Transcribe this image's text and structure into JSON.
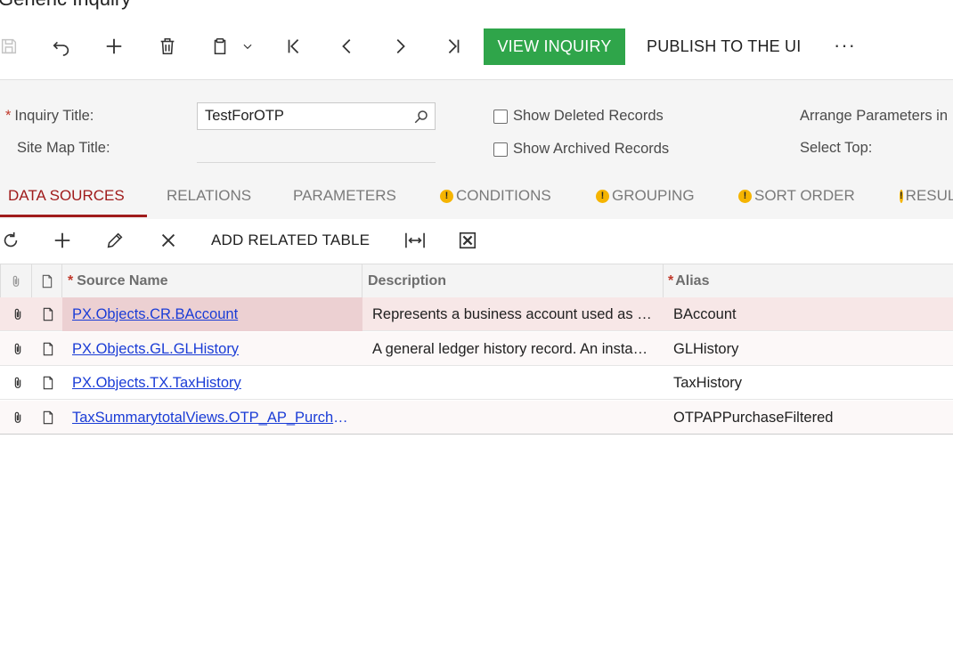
{
  "page": {
    "title": "Generic Inquiry"
  },
  "toolbar": {
    "view_inquiry": "VIEW INQUIRY",
    "publish": "PUBLISH TO THE UI",
    "more": "···",
    "accent": "#2fa54a"
  },
  "form": {
    "inquiry_title_label": "Inquiry Title:",
    "inquiry_title_value": "TestForOTP",
    "site_map_title_label": "Site Map Title:",
    "show_deleted_label": "Show Deleted Records",
    "show_archived_label": "Show Archived Records",
    "arrange_params_label": "Arrange Parameters in",
    "select_top_label": "Select Top:"
  },
  "tabs": [
    {
      "label": "DATA SOURCES",
      "active": true,
      "warning": false
    },
    {
      "label": "RELATIONS",
      "active": false,
      "warning": false
    },
    {
      "label": "PARAMETERS",
      "active": false,
      "warning": false
    },
    {
      "label": "CONDITIONS",
      "active": false,
      "warning": true
    },
    {
      "label": "GROUPING",
      "active": false,
      "warning": true
    },
    {
      "label": "SORT ORDER",
      "active": false,
      "warning": true
    },
    {
      "label": "RESULTS",
      "active": false,
      "warning": true
    }
  ],
  "grid_toolbar": {
    "add_related_table": "ADD RELATED TABLE"
  },
  "grid": {
    "columns": {
      "source_name": "Source Name",
      "description": "Description",
      "alias": "Alias"
    },
    "rows": [
      {
        "source": "PX.Objects.CR.BAccount",
        "description": "Represents a business account used as a base",
        "alias": "BAccount"
      },
      {
        "source": "PX.Objects.GL.GLHistory",
        "description": "A general ledger history record. An instance of",
        "alias": "GLHistory"
      },
      {
        "source": "PX.Objects.TX.TaxHistory",
        "description": "",
        "alias": "TaxHistory"
      },
      {
        "source": "TaxSummarytotalViews.OTP_AP_PurchaseFiltered",
        "description": "",
        "alias": "OTPAPPurchaseFiltered"
      }
    ]
  }
}
